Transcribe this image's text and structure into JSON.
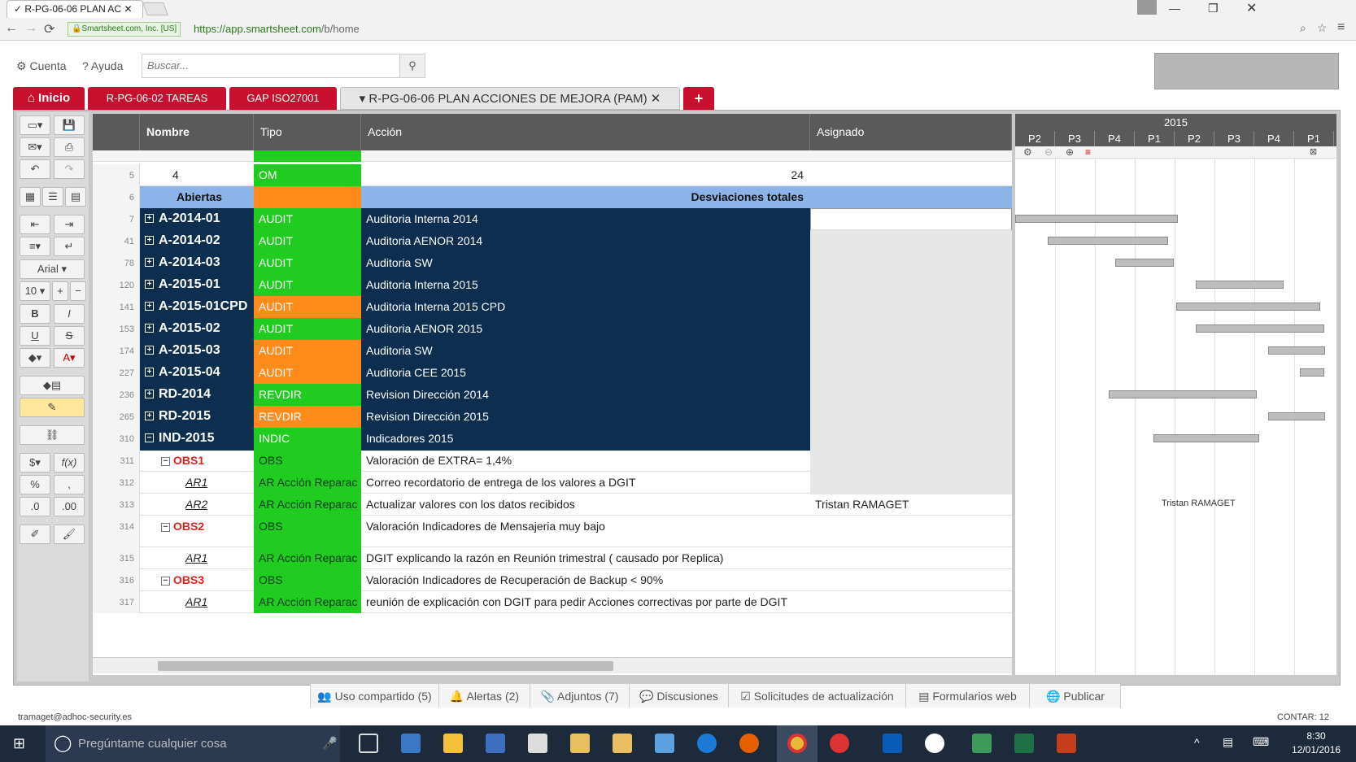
{
  "browser": {
    "tab_title": "R-PG-06-06 PLAN AC",
    "secure_label": "Smartsheet.com, Inc. [US]",
    "url_host": "https://app.smartsheet.com",
    "url_path": "/b/home"
  },
  "topbar": {
    "account_label": "Cuenta",
    "help_label": "Ayuda",
    "search_placeholder": "Buscar..."
  },
  "tabs": [
    {
      "label": "Inicio"
    },
    {
      "label": "R-PG-06-02 TAREAS"
    },
    {
      "label": "GAP ISO27001"
    },
    {
      "label": "R-PG-06-06 PLAN ACCIONES DE MEJORA (PAM)"
    }
  ],
  "toolbar": {
    "font_name": "Arial",
    "font_size": "10"
  },
  "grid": {
    "headers": {
      "name": "Nombre",
      "type": "Tipo",
      "action": "Acción",
      "assigned": "Asignado"
    },
    "rows": [
      {
        "num": "5",
        "name": "4",
        "type": "OM",
        "action": "24",
        "assigned": ""
      },
      {
        "num": "6",
        "name": "Abiertas",
        "type": "",
        "action": "Desviaciones totales",
        "assigned": ""
      },
      {
        "num": "7",
        "name": "A-2014-01",
        "type": "AUDIT",
        "action": "Auditoria Interna 2014",
        "assigned": ""
      },
      {
        "num": "41",
        "name": "A-2014-02",
        "type": "AUDIT",
        "action": "Auditoria AENOR 2014",
        "assigned": ""
      },
      {
        "num": "78",
        "name": "A-2014-03",
        "type": "AUDIT",
        "action": "Auditoria SW",
        "assigned": ""
      },
      {
        "num": "120",
        "name": "A-2015-01",
        "type": "AUDIT",
        "action": "Auditoria Interna 2015",
        "assigned": ""
      },
      {
        "num": "141",
        "name": "A-2015-01CPD",
        "type": "AUDIT",
        "action": "Auditoria Interna 2015 CPD",
        "assigned": ""
      },
      {
        "num": "153",
        "name": "A-2015-02",
        "type": "AUDIT",
        "action": "Auditoria AENOR 2015",
        "assigned": ""
      },
      {
        "num": "174",
        "name": "A-2015-03",
        "type": "AUDIT",
        "action": "Auditoria SW",
        "assigned": ""
      },
      {
        "num": "227",
        "name": "A-2015-04",
        "type": "AUDIT",
        "action": "Auditoria CEE 2015",
        "assigned": ""
      },
      {
        "num": "236",
        "name": "RD-2014",
        "type": "REVDIR",
        "action": "Revision Dirección 2014",
        "assigned": ""
      },
      {
        "num": "265",
        "name": "RD-2015",
        "type": "REVDIR",
        "action": "Revision Dirección 2015",
        "assigned": ""
      },
      {
        "num": "310",
        "name": "IND-2015",
        "type": "INDIC",
        "action": "Indicadores 2015",
        "assigned": ""
      },
      {
        "num": "311",
        "name": "OBS1",
        "type": "OBS",
        "action": "Valoración de EXTRA= 1,4%",
        "assigned": ""
      },
      {
        "num": "312",
        "name": "AR1",
        "type": "AR Acción Reparac",
        "action": "Correo recordatorio de entrega de los valores a DGIT",
        "assigned": ""
      },
      {
        "num": "313",
        "name": "AR2",
        "type": "AR Acción Reparac",
        "action": "Actualizar valores con los datos recibidos",
        "assigned": "Tristan RAMAGET"
      },
      {
        "num": "314",
        "name": "OBS2",
        "type": "OBS",
        "action": "Valoración Indicadores de Mensajeria muy bajo",
        "assigned": ""
      },
      {
        "num": "315",
        "name": "AR1",
        "type": "AR Acción Reparac",
        "action": "DGIT explicando la razón en Reunión trimestral ( causado por Replica)",
        "assigned": ""
      },
      {
        "num": "316",
        "name": "OBS3",
        "type": "OBS",
        "action": "Valoración Indicadores de Recuperación de Backup < 90%",
        "assigned": ""
      },
      {
        "num": "317",
        "name": "AR1",
        "type": "AR Acción Reparac",
        "action": "reunión de explicación con DGIT para pedir Acciones correctivas por parte de DGIT",
        "assigned": ""
      }
    ]
  },
  "gantt": {
    "year": "2015",
    "periods": [
      "P2",
      "P3",
      "P4",
      "P1",
      "P2",
      "P3",
      "P4",
      "P1"
    ],
    "assigned_label": "Tristan RAMAGET"
  },
  "bottom_tabs": [
    {
      "label": "Uso compartido (5)"
    },
    {
      "label": "Alertas (2)"
    },
    {
      "label": "Adjuntos (7)"
    },
    {
      "label": "Discusiones"
    },
    {
      "label": "Solicitudes de actualización"
    },
    {
      "label": "Formularios web"
    },
    {
      "label": "Publicar"
    }
  ],
  "status": {
    "email": "tramaget@adhoc-security.es",
    "count": "CONTAR: 12"
  },
  "taskbar": {
    "search_placeholder": "Pregúntame cualquier cosa",
    "time": "8:30",
    "date": "12/01/2016"
  },
  "colors": {
    "brand_red": "#c8102e",
    "row_navy": "#0d2e4f",
    "type_green": "#1fcc1f",
    "type_orange": "#ff8c1a",
    "summary_blue": "#8db4e8",
    "obs_red": "#e0201b"
  }
}
